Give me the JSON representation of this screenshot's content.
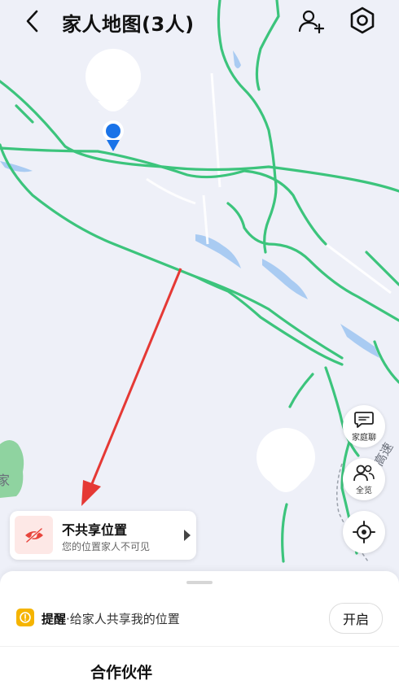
{
  "header": {
    "title": "家人地图(3人)",
    "back_icon": "chevron-left-icon",
    "add_icon": "add-user-icon",
    "settings_icon": "gear-icon"
  },
  "map": {
    "road_color": "#3cc47c",
    "water_color": "#a9cbf2",
    "background_color": "#eef0f8",
    "location_marker_color": "#1a73e8",
    "arrow_color": "#e53935",
    "labels": [
      "家",
      "高速"
    ]
  },
  "float_buttons": {
    "chat_label": "家庭聊",
    "overview_label": "全览",
    "locate_icon": "crosshair-icon"
  },
  "share_card": {
    "title": "不共享位置",
    "subtitle": "您的位置家人不可见",
    "icon": "eye-off-icon"
  },
  "sheet": {
    "remind_label": "提醒",
    "remind_sep": "·",
    "remind_text": "给家人共享我的位置",
    "open_button": "开启",
    "partner_title": "合作伙伴"
  }
}
